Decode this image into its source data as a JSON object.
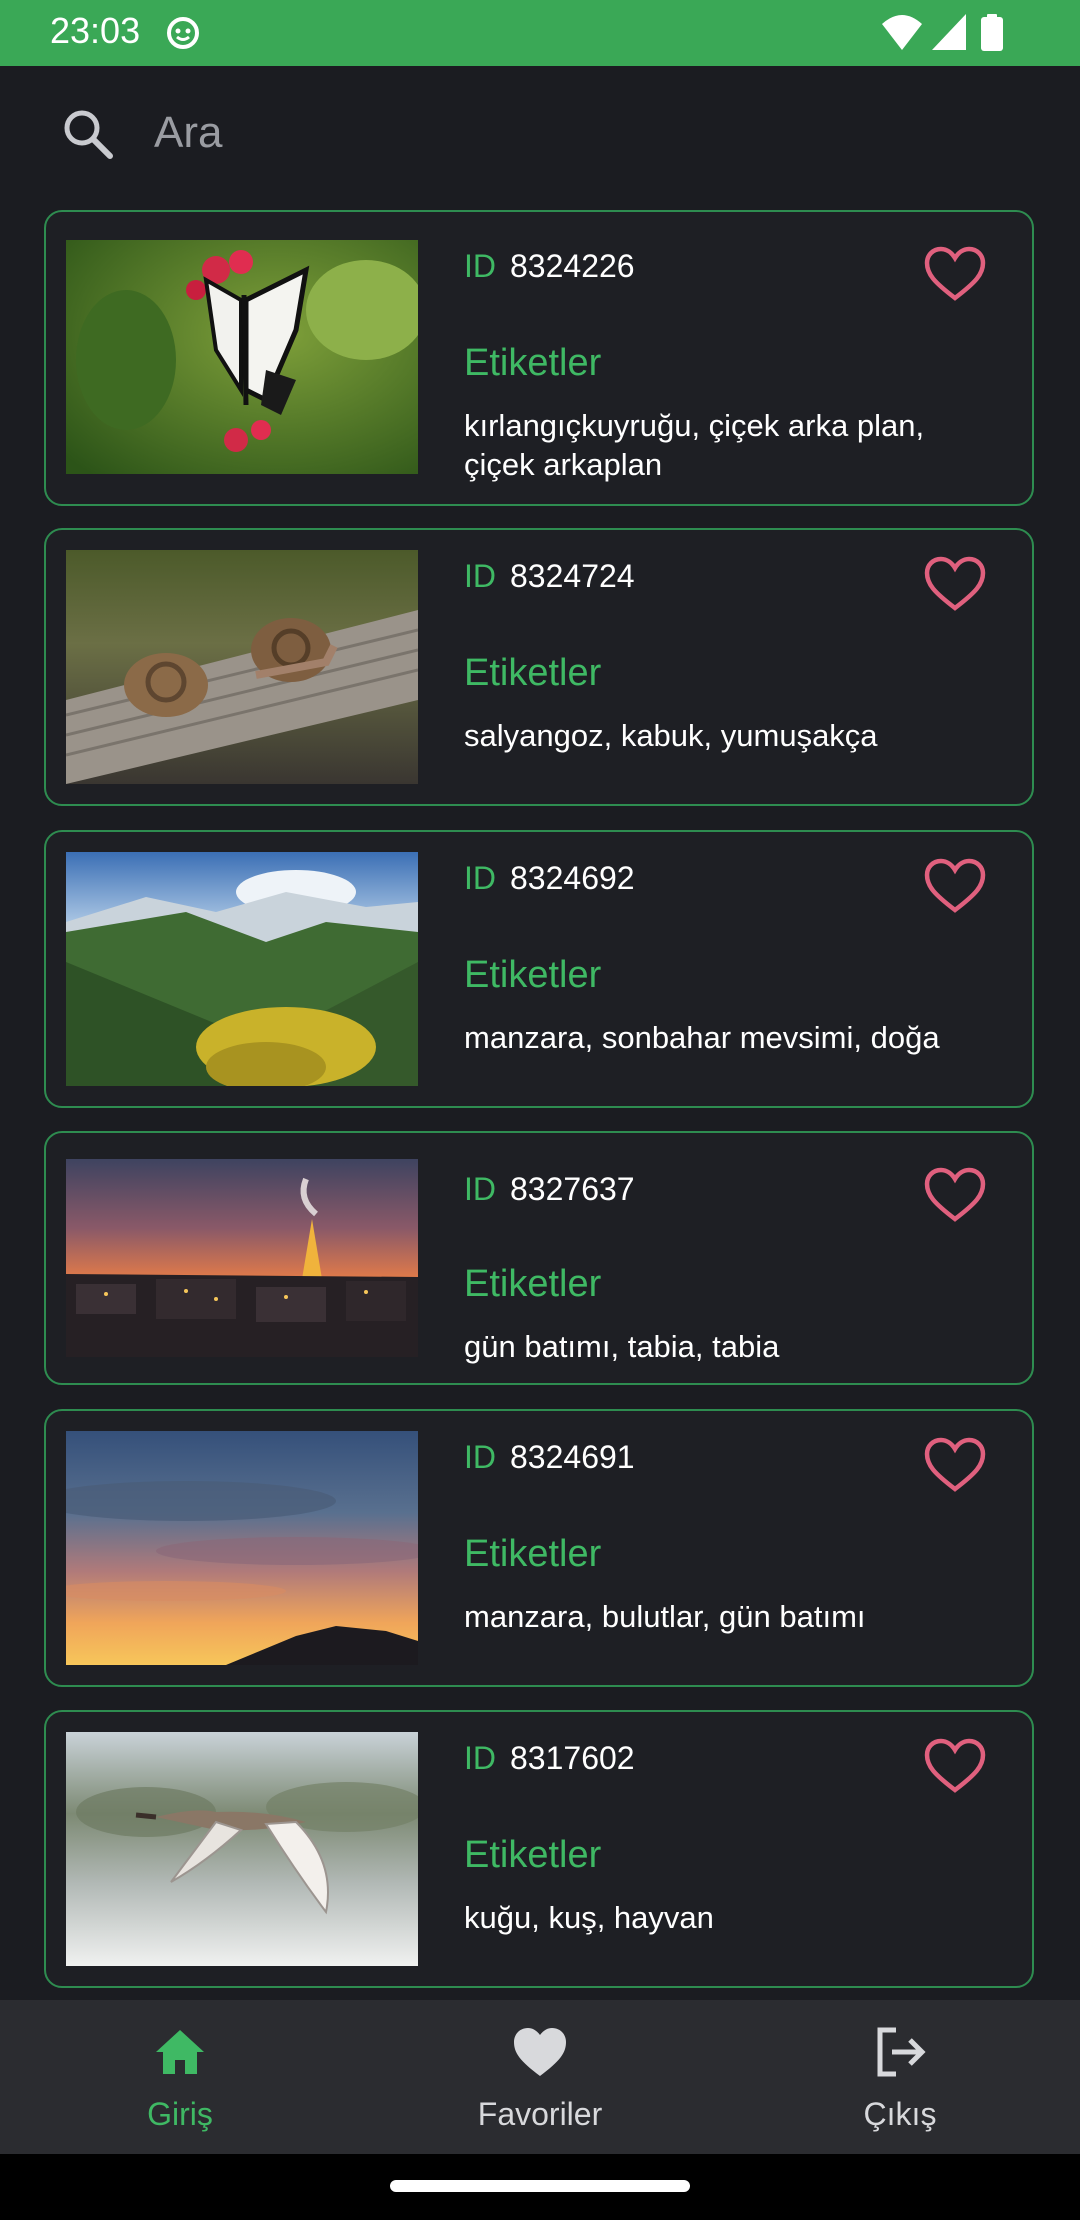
{
  "status_bar": {
    "time": "23:03"
  },
  "search": {
    "placeholder": "Ara"
  },
  "cards": [
    {
      "id_label": "ID",
      "id": "8324226",
      "tags_label": "Etiketler",
      "tags": "kırlangıçkuyruğu, çiçek arka plan, çiçek arkaplan",
      "image": "butterfly-photo"
    },
    {
      "id_label": "ID",
      "id": "8324724",
      "tags_label": "Etiketler",
      "tags": "salyangoz, kabuk, yumuşakça",
      "image": "snail-photo"
    },
    {
      "id_label": "ID",
      "id": "8324692",
      "tags_label": "Etiketler",
      "tags": "manzara, sonbahar mevsimi, doğa",
      "image": "mountain-valley-photo"
    },
    {
      "id_label": "ID",
      "id": "8327637",
      "tags_label": "Etiketler",
      "tags": "gün batımı, tabia, tabia",
      "image": "eiffel-sunset-photo"
    },
    {
      "id_label": "ID",
      "id": "8324691",
      "tags_label": "Etiketler",
      "tags": "manzara, bulutlar, gün batımı",
      "image": "cloudy-sunset-photo"
    },
    {
      "id_label": "ID",
      "id": "8317602",
      "tags_label": "Etiketler",
      "tags": "kuğu, kuş, hayvan",
      "image": "swan-photo"
    }
  ],
  "bottom_nav": {
    "home": "Giriş",
    "favorites": "Favoriler",
    "logout": "Çıkış"
  },
  "colors": {
    "accent": "#3fb964",
    "status_bar": "#3aa856",
    "card_border": "#2e8c50",
    "heart": "#e0607e",
    "background": "#1b1c21"
  }
}
